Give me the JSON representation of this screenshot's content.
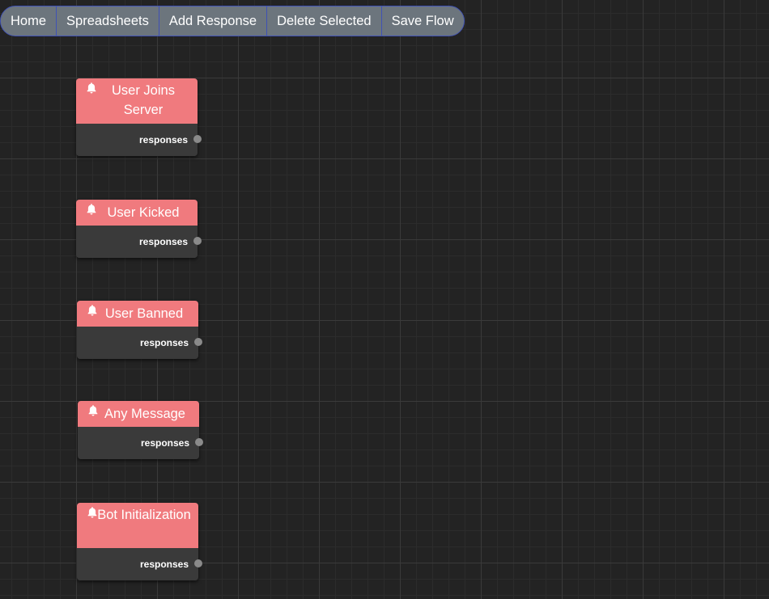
{
  "toolbar": {
    "buttons": [
      {
        "label": "Home"
      },
      {
        "label": "Spreadsheets"
      },
      {
        "label": "Add Response"
      },
      {
        "label": "Delete Selected"
      },
      {
        "label": "Save Flow"
      }
    ]
  },
  "nodes": [
    {
      "title": "User Joins Server",
      "port_label": "responses",
      "icon": "bell-icon"
    },
    {
      "title": "User Kicked",
      "port_label": "responses",
      "icon": "bell-icon"
    },
    {
      "title": "User Banned",
      "port_label": "responses",
      "icon": "bell-icon"
    },
    {
      "title": "Any Message",
      "port_label": "responses",
      "icon": "bell-icon"
    },
    {
      "title": "Bot Initialization",
      "port_label": "responses",
      "icon": "bell-icon"
    }
  ],
  "colors": {
    "canvas_bg": "#232323",
    "node_header": "#f07a7e",
    "node_body": "#3a3a3a",
    "toolbar_bg": "#6c757d",
    "toolbar_border": "#3f51b5",
    "port": "#8a8a8a"
  }
}
